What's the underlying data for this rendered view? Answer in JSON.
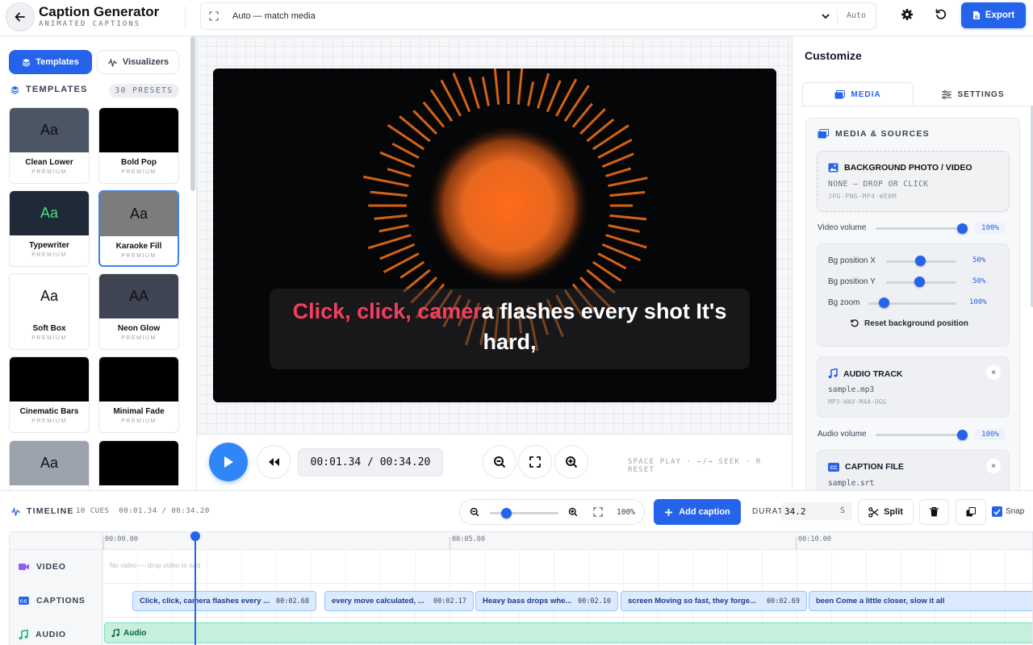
{
  "app": {
    "title": "Caption Generator",
    "subtitle": "ANIMATED CAPTIONS"
  },
  "aspect": {
    "label": "Auto — match media",
    "mode": "Auto"
  },
  "toolbar": {
    "export_label": "Export"
  },
  "left_panel": {
    "tabs": [
      {
        "label": "Templates",
        "active": true
      },
      {
        "label": "Visualizers",
        "active": false
      }
    ],
    "section_title": "TEMPLATES",
    "presets_count": "30 PRESETS",
    "templates": [
      {
        "name": "Clean Lower",
        "tier": "PREMIUM",
        "preview": "Aa",
        "bg": "#4b5563",
        "fg": "#111111"
      },
      {
        "name": "Bold Pop",
        "tier": "PREMIUM",
        "preview": "",
        "bg": "#000000",
        "fg": "#ffffff"
      },
      {
        "name": "Typewriter",
        "tier": "PREMIUM",
        "preview": "Aa",
        "bg": "#1f2937",
        "fg": "#4ade80"
      },
      {
        "name": "Karaoke Fill",
        "tier": "PREMIUM",
        "preview": "Aa",
        "bg": "#7c7c7c",
        "fg": "#111111",
        "selected": true
      },
      {
        "name": "Soft Box",
        "tier": "PREMIUM",
        "preview": "Aa",
        "bg": "#ffffff",
        "fg": "#111111"
      },
      {
        "name": "Neon Glow",
        "tier": "PREMIUM",
        "preview": "AA",
        "bg": "#3f4452",
        "fg": "#111111"
      },
      {
        "name": "Cinematic Bars",
        "tier": "PREMIUM",
        "preview": "",
        "bg": "#000000",
        "fg": "#ffffff"
      },
      {
        "name": "Minimal Fade",
        "tier": "PREMIUM",
        "preview": "",
        "bg": "#000000",
        "fg": "#ffffff"
      },
      {
        "name": "",
        "tier": "",
        "preview": "Aa",
        "bg": "#9ca3af",
        "fg": "#111111"
      },
      {
        "name": "",
        "tier": "",
        "preview": "",
        "bg": "#000000",
        "fg": "#ffffff"
      }
    ]
  },
  "preview": {
    "caption_highlight": "Click, click, camer",
    "caption_rest": "a flashes every shot It's hard,",
    "visualizer_color": "#f97316"
  },
  "transport": {
    "time": "00:01.34 / 00:34.20",
    "hint": "SPACE PLAY · ←/→ SEEK · R RESET"
  },
  "right_panel": {
    "title": "Customize",
    "tabs": [
      {
        "label": "MEDIA",
        "active": true
      },
      {
        "label": "SETTINGS",
        "active": false
      }
    ],
    "section": "MEDIA & SOURCES",
    "background": {
      "title": "BACKGROUND PHOTO / VIDEO",
      "status": "NONE — DROP OR CLICK",
      "formats": "JPG·PNG·MP4·WEBM"
    },
    "video_volume": {
      "label": "Video volume",
      "value": "100%",
      "level": 1.0
    },
    "bg_position_x": {
      "label": "Bg position X",
      "value": "50%",
      "level": 0.5
    },
    "bg_position_y": {
      "label": "Bg position Y",
      "value": "50%",
      "level": 0.5
    },
    "bg_zoom": {
      "label": "Bg zoom",
      "value": "100%",
      "level": 0.2
    },
    "reset_label": "Reset background position",
    "audio_track": {
      "title": "AUDIO TRACK",
      "file": "sample.mp3",
      "formats": "MP3·WAV·M4A·OGG",
      "remove": "×"
    },
    "audio_volume": {
      "label": "Audio volume",
      "value": "100%",
      "level": 1.0
    },
    "caption_file": {
      "title": "CAPTION FILE",
      "file": "sample.srt",
      "remove": "×"
    }
  },
  "timeline": {
    "title": "TIMELINE",
    "cues": "10 CUES",
    "time": "00:01.34 / 00:34.20",
    "zoom": "100%",
    "zoom_level": 0.25,
    "add_caption": "Add caption",
    "duration_label": "DURATION",
    "duration_value": "34.2",
    "duration_unit": "S",
    "split_label": "Split",
    "snap_label": "Snap",
    "ruler": [
      "00:00.00",
      "00:05.00",
      "00:10.00"
    ],
    "lanes": {
      "video": "VIDEO",
      "captions": "CAPTIONS",
      "audio": "AUDIO"
    },
    "video_empty": "No video — drop video to add",
    "audio_clip": "Audio",
    "clips": [
      {
        "text": "Click, click, camera flashes every ...",
        "dur": "00:02.68"
      },
      {
        "text": "every move calculated, ...",
        "dur": "00:02.17"
      },
      {
        "text": "Heavy bass drops whe...",
        "dur": "00:02.10"
      },
      {
        "text": "screen Moving so fast, they forge...",
        "dur": "00:02.69"
      },
      {
        "text": "been Come a little closer, slow it all",
        "dur": ""
      }
    ]
  }
}
